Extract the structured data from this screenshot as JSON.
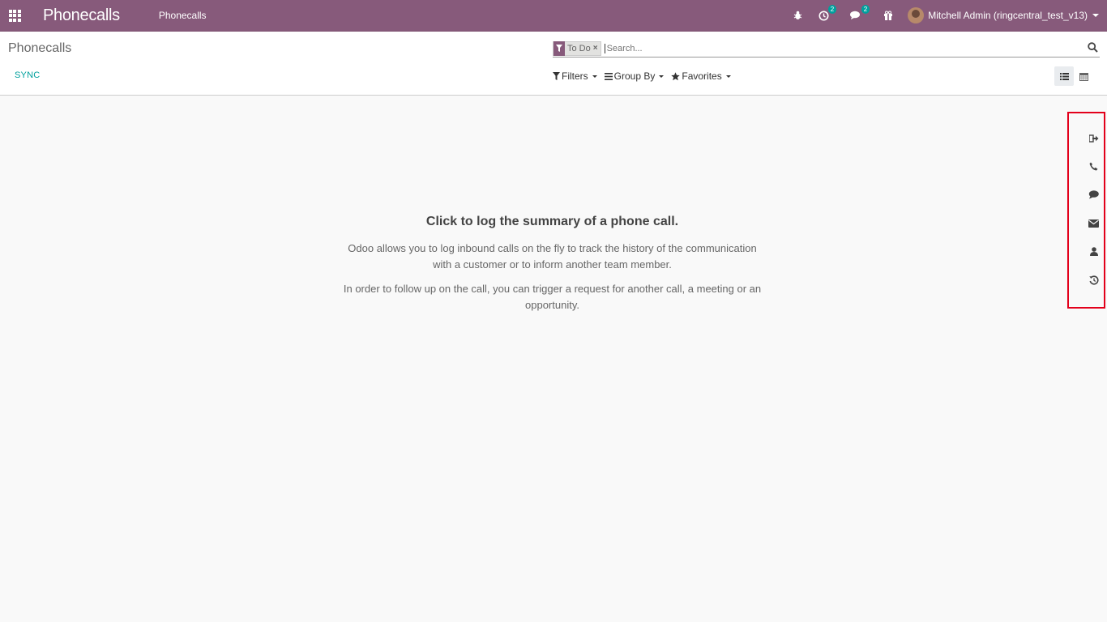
{
  "navbar": {
    "brand": "Phonecalls",
    "menu_item": "Phonecalls",
    "activity_count": "2",
    "messages_count": "2",
    "user_name": "Mitchell Admin (ringcentral_test_v13)"
  },
  "control_panel": {
    "title": "Phonecalls",
    "sync_label": "SYNC",
    "search": {
      "facet_label": "To Do",
      "placeholder": "Search..."
    },
    "filters_label": "Filters",
    "group_by_label": "Group By",
    "favorites_label": "Favorites"
  },
  "empty_state": {
    "title": "Click to log the summary of a phone call.",
    "paragraph_1": "Odoo allows you to log inbound calls on the fly to track the history of the communication with a customer or to inform another team member.",
    "paragraph_2": "In order to follow up on the call, you can trigger a request for another call, a meeting or an opportunity."
  },
  "side_toolbar": {
    "icons": [
      "sign-out-icon",
      "phone-icon",
      "comment-icon",
      "envelope-icon",
      "user-icon",
      "history-icon"
    ]
  },
  "colors": {
    "brand": "#875a7b",
    "accent": "#00a09d",
    "highlight_border": "#e3001b"
  }
}
